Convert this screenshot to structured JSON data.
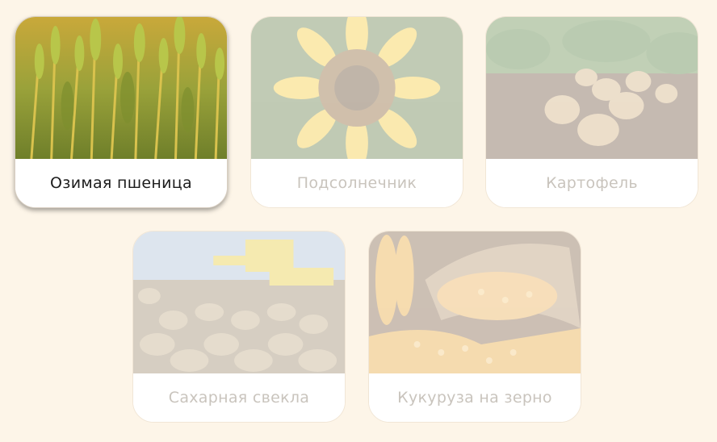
{
  "crops": [
    {
      "label": "Озимая пшеница",
      "active": true,
      "image": "wheat-field-photo"
    },
    {
      "label": "Подсолнечник",
      "active": false,
      "image": "sunflower-photo"
    },
    {
      "label": "Картофель",
      "active": false,
      "image": "potato-photo"
    },
    {
      "label": "Сахарная свекла",
      "active": false,
      "image": "sugar-beet-harvest-photo"
    },
    {
      "label": "Кукуруза на зерно",
      "active": false,
      "image": "corn-grain-sack-photo"
    }
  ],
  "colors": {
    "background": "#fdf5e8",
    "active_text": "#1c1c1c",
    "inactive_text": "#c9c4bd"
  }
}
